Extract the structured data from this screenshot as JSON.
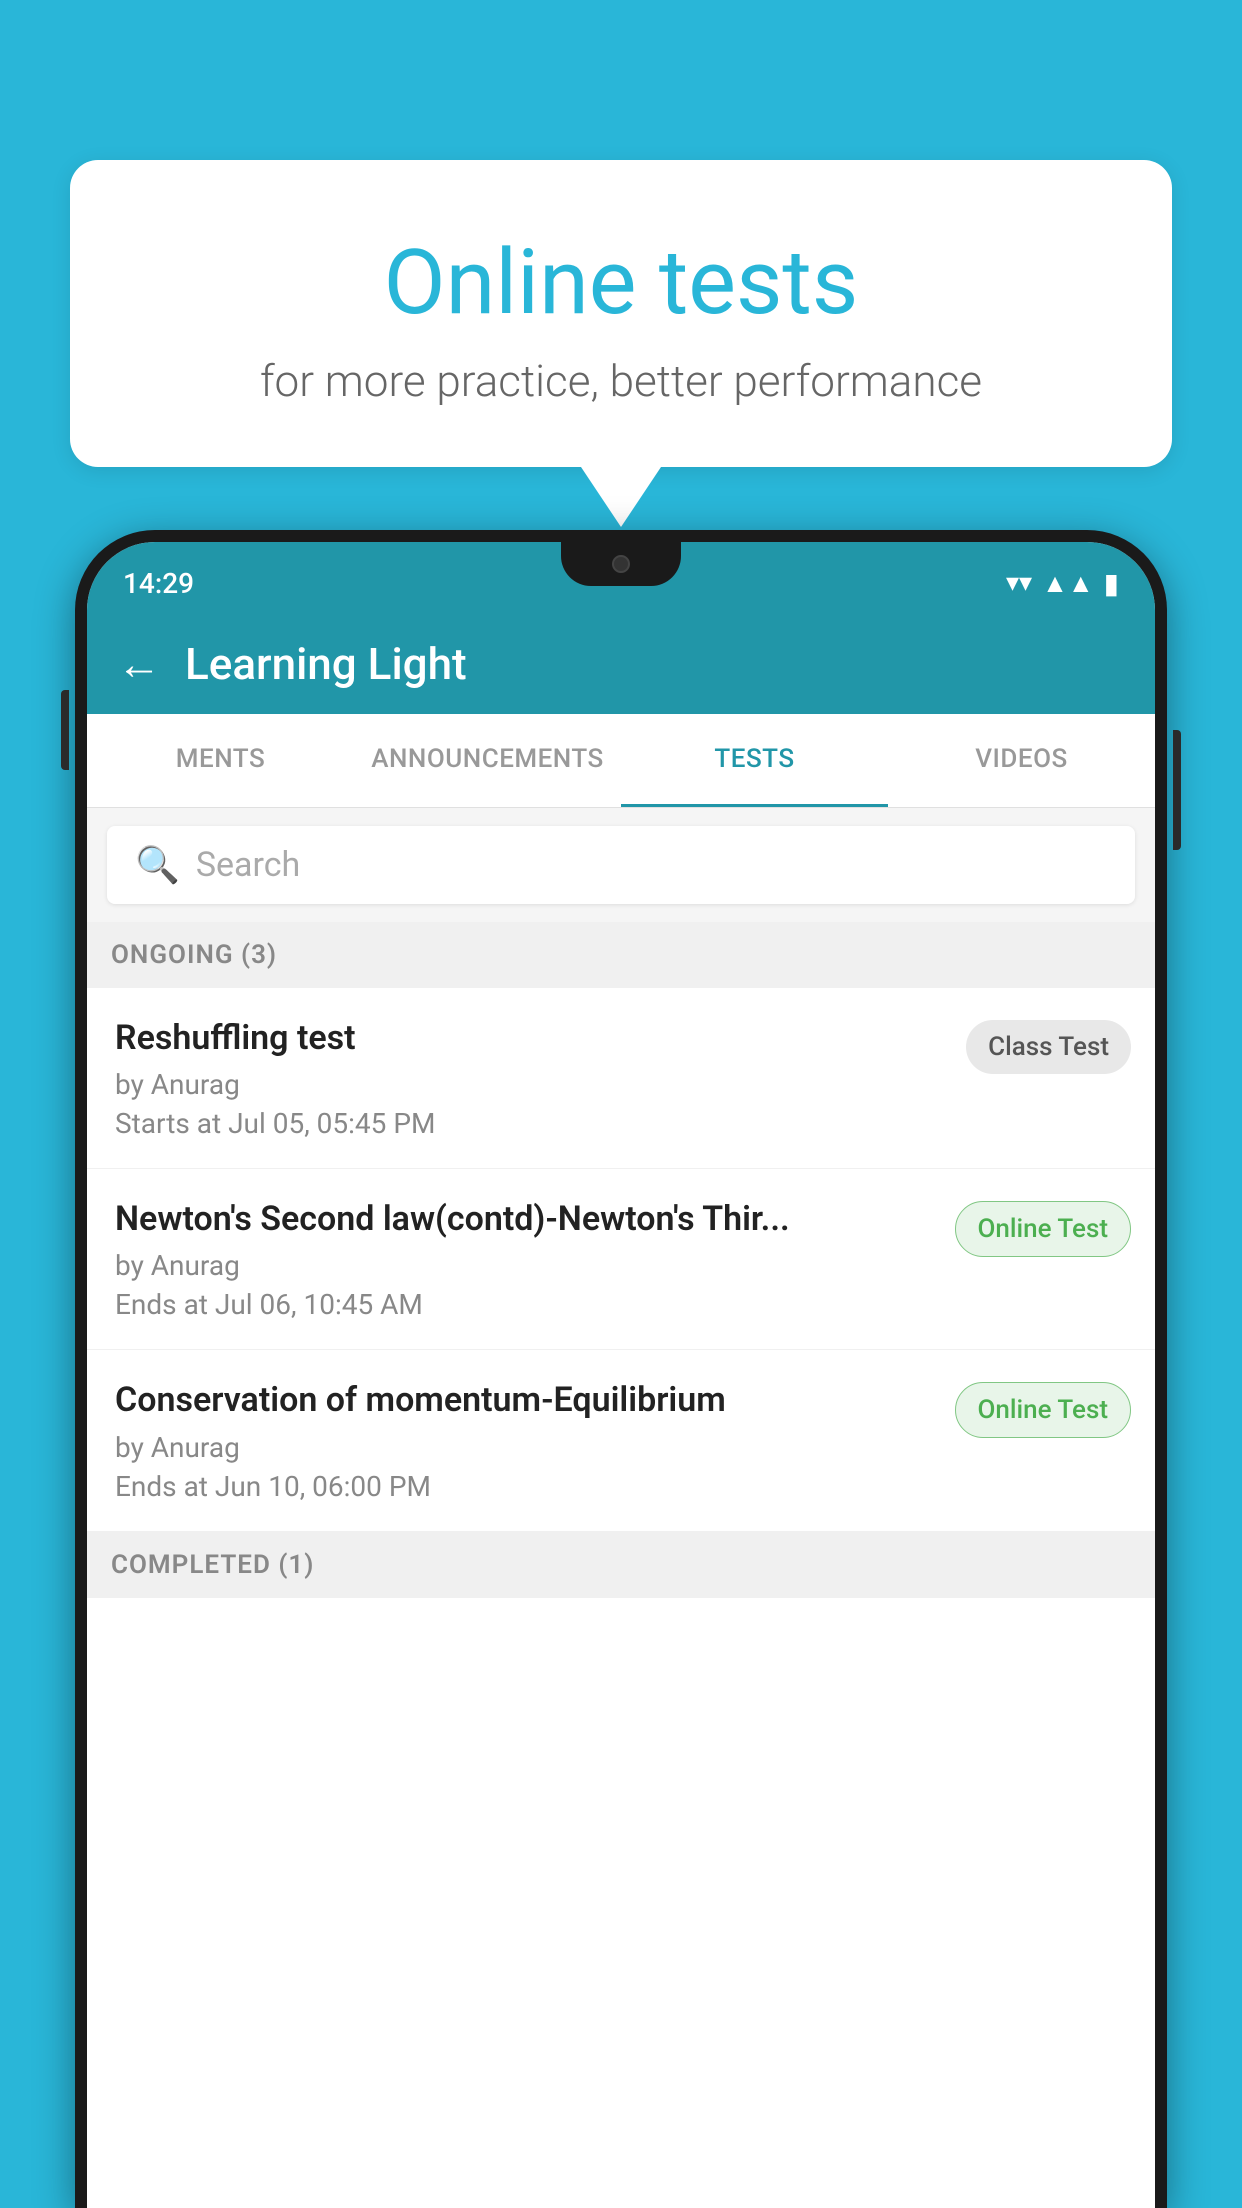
{
  "background_color": "#29B6D8",
  "speech_bubble": {
    "title": "Online tests",
    "subtitle": "for more practice, better performance"
  },
  "status_bar": {
    "time": "14:29",
    "wifi": "▼",
    "signal": "▲",
    "battery": "▮"
  },
  "app_bar": {
    "title": "Learning Light",
    "back_label": "←"
  },
  "tabs": [
    {
      "label": "MENTS",
      "active": false
    },
    {
      "label": "ANNOUNCEMENTS",
      "active": false
    },
    {
      "label": "TESTS",
      "active": true
    },
    {
      "label": "VIDEOS",
      "active": false
    }
  ],
  "search": {
    "placeholder": "Search"
  },
  "ongoing_section": {
    "label": "ONGOING (3)"
  },
  "tests": [
    {
      "title": "Reshuffling test",
      "author": "by Anurag",
      "time_label": "Starts at",
      "time": "Jul 05, 05:45 PM",
      "badge": "Class Test",
      "badge_type": "class"
    },
    {
      "title": "Newton's Second law(contd)-Newton's Thir...",
      "author": "by Anurag",
      "time_label": "Ends at",
      "time": "Jul 06, 10:45 AM",
      "badge": "Online Test",
      "badge_type": "online"
    },
    {
      "title": "Conservation of momentum-Equilibrium",
      "author": "by Anurag",
      "time_label": "Ends at",
      "time": "Jun 10, 06:00 PM",
      "badge": "Online Test",
      "badge_type": "online"
    }
  ],
  "completed_section": {
    "label": "COMPLETED (1)"
  }
}
